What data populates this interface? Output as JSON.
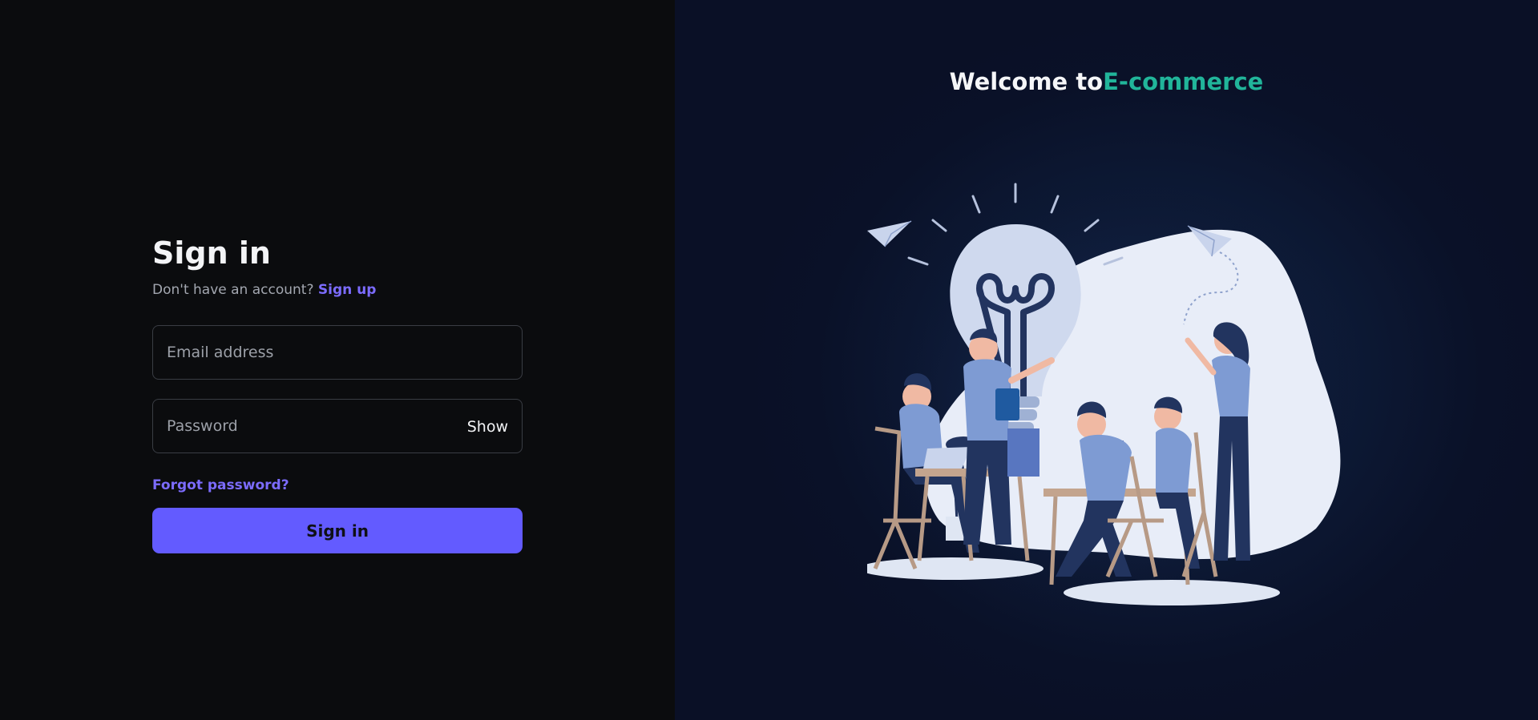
{
  "signin": {
    "title": "Sign in",
    "no_account_text": "Don't have an account? ",
    "signup_link": "Sign up",
    "email_placeholder": "Email address",
    "email_value": "",
    "password_placeholder": "Password",
    "password_value": "",
    "show_label": "Show",
    "forgot_link": "Forgot password?",
    "submit_label": "Sign in"
  },
  "hero": {
    "welcome_text": "Welcome to",
    "brand_text": "E-commerce",
    "illustration": "team-idea-lightbulb-illustration"
  },
  "colors": {
    "left_bg": "#0b0c0e",
    "right_bg": "#0a1128",
    "accent": "#635bff",
    "link": "#7c6cff",
    "brand": "#21b59a"
  }
}
